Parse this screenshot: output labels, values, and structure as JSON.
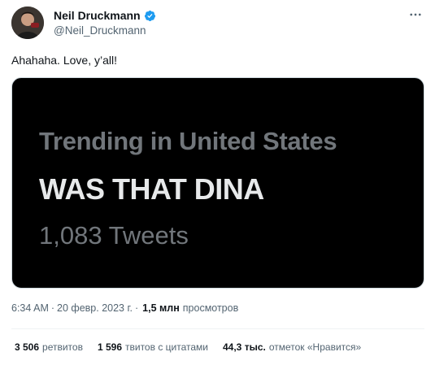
{
  "author": {
    "name": "Neil Druckmann",
    "handle": "@Neil_Druckmann",
    "verified_color": "#1d9bf0"
  },
  "tweet": {
    "text": "Ahahaha. Love, y’all!"
  },
  "media": {
    "context": "Trending in United States",
    "trend": "WAS THAT DINA",
    "count": "1,083 Tweets"
  },
  "meta": {
    "time": "6:34 AM",
    "separator": "·",
    "date": "20 февр. 2023 г.",
    "separator2": "·",
    "views_count": "1,5 млн",
    "views_label": "просмотров"
  },
  "stats": {
    "retweets_num": "3 506",
    "retweets_label": "ретвитов",
    "quotes_num": "1 596",
    "quotes_label": "твитов с цитатами",
    "likes_num": "44,3 тыс.",
    "likes_label": "отметок «Нравится»"
  },
  "icons": {
    "more": "more-horizontal-icon",
    "verified": "verified-badge-icon",
    "avatar": "avatar-image"
  }
}
